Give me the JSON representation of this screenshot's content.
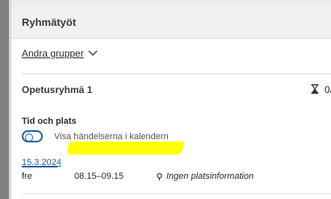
{
  "header": {
    "title": "Ryhmätyöt"
  },
  "groups_selector": {
    "label": "Andra grupper",
    "icon": "chevron-down-icon"
  },
  "group": {
    "name": "Opetusryhmä 1",
    "count_icon": "hourglass-icon",
    "count": "0/"
  },
  "time_place": {
    "title": "Tid och plats",
    "toggle_label": "Visa händelserna i kalendern",
    "toggle_on": false
  },
  "event": {
    "date": "15.3.2024",
    "weekday": "fre",
    "time": "08.15–09.15",
    "location_icon": "location-pin-icon",
    "location": "Ingen platsinformation"
  },
  "colors": {
    "accent": "#1f5fa8",
    "redaction": "#ffff00"
  }
}
